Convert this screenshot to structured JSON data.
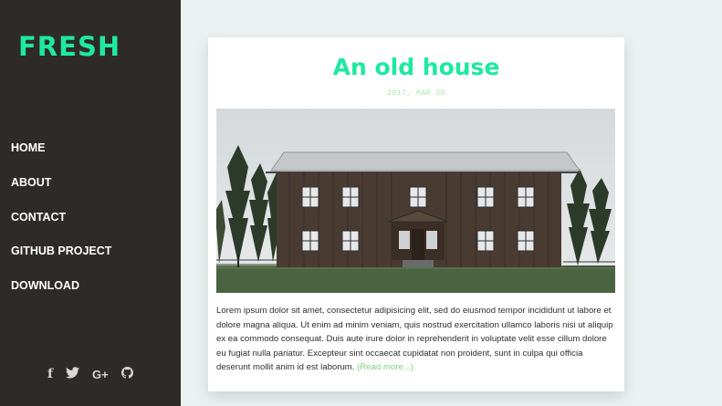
{
  "site": {
    "logo": "FRESH"
  },
  "nav": {
    "items": [
      {
        "label": "HOME"
      },
      {
        "label": "ABOUT"
      },
      {
        "label": "CONTACT"
      },
      {
        "label": "GITHUB PROJECT"
      },
      {
        "label": "DOWNLOAD"
      }
    ]
  },
  "social": {
    "icons": [
      "facebook-icon",
      "twitter-icon",
      "google-plus-icon",
      "github-icon"
    ],
    "facebook": "f",
    "google_plus": "G+"
  },
  "post": {
    "title": "An old house",
    "date": "2017, MAR 30",
    "excerpt": "Lorem ipsum dolor sit amet, consectetur adipisicing elit, sed do eiusmod tempor incididunt ut labore et dolore magna aliqua. Ut enim ad minim veniam, quis nostrud exercitation ullamco laboris nisi ut aliquip ex ea commodo consequat. Duis aute irure dolor in reprehenderit in voluptate velit esse cillum dolore eu fugiat nulla pariatur. Excepteur sint occaecat cupidatat non proident, sunt in culpa qui officia deserunt mollit anim id est laborum.",
    "read_more": "(Read more...)"
  },
  "colors": {
    "sidebar": "#2e2a29",
    "accent": "#1de9a0",
    "background": "#ebf0f0",
    "link": "#7fd37f"
  }
}
